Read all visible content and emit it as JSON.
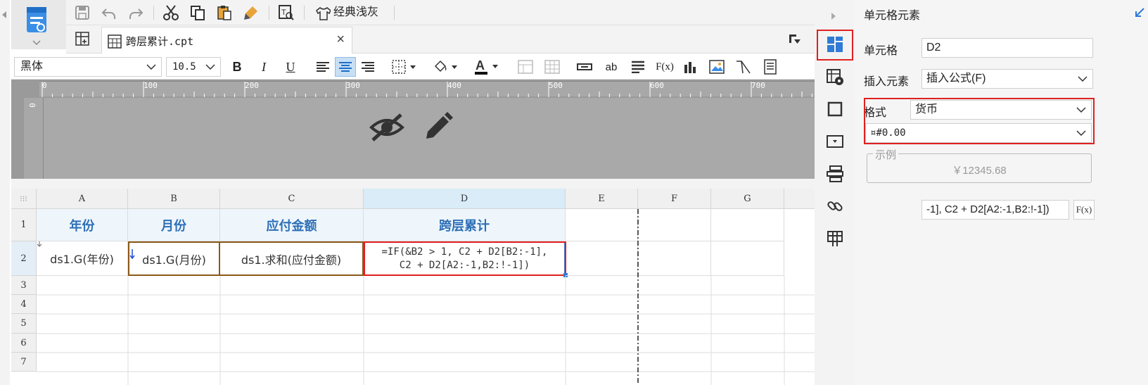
{
  "toolbar": {
    "theme_label": "经典浅灰",
    "icons": [
      "save-icon",
      "undo-icon",
      "redo-icon",
      "cut-icon",
      "copy-icon",
      "paste-icon",
      "format-painter-icon",
      "preview-icon",
      "theme-icon"
    ]
  },
  "tab": {
    "file_name": "跨层累计.cpt",
    "close": "×"
  },
  "format": {
    "font_name": "黑体",
    "font_size": "10.5",
    "bold": "B",
    "italic": "I",
    "underline": "U",
    "insert_text_ab": "ab",
    "insert_formula": "F(x)"
  },
  "ruler": {
    "ticks": [
      "0",
      "100",
      "200",
      "300",
      "400",
      "500",
      "600",
      "700"
    ],
    "vertical_tick": "0"
  },
  "grid": {
    "columns": [
      "A",
      "B",
      "C",
      "D",
      "E",
      "F",
      "G"
    ],
    "rows": [
      "1",
      "2",
      "3",
      "4",
      "5",
      "6",
      "7"
    ],
    "header_row": [
      "年份",
      "月份",
      "应付金额",
      "跨层累计"
    ],
    "data_row": [
      "ds1.G(年份)",
      "ds1.G(月份)",
      "ds1.求和(应付金额)"
    ],
    "formula_line1": "=IF(&B2 > 1, C2 + D2[B2:-1],",
    "formula_line2": "C2 + D2[A2:-1,B2:!-1])"
  },
  "panel": {
    "title": "单元格元素",
    "cell_label": "单元格",
    "cell_value": "D2",
    "insert_label": "插入元素",
    "insert_value": "插入公式(F)",
    "format_label": "格式",
    "format_value": "货币",
    "pattern_value": "¤#0.00",
    "sample_label": "示例",
    "sample_value": "￥12345.68",
    "formula_value": "-1], C2 + D2[A2:-1,B2:!-1])",
    "fx_label": "F(x)"
  },
  "colors": {
    "highlight_red": "#e02020",
    "header_text": "#2d6fb6",
    "selection_blue": "#2f7bd6",
    "ruler_gray": "#a9a9a9"
  }
}
